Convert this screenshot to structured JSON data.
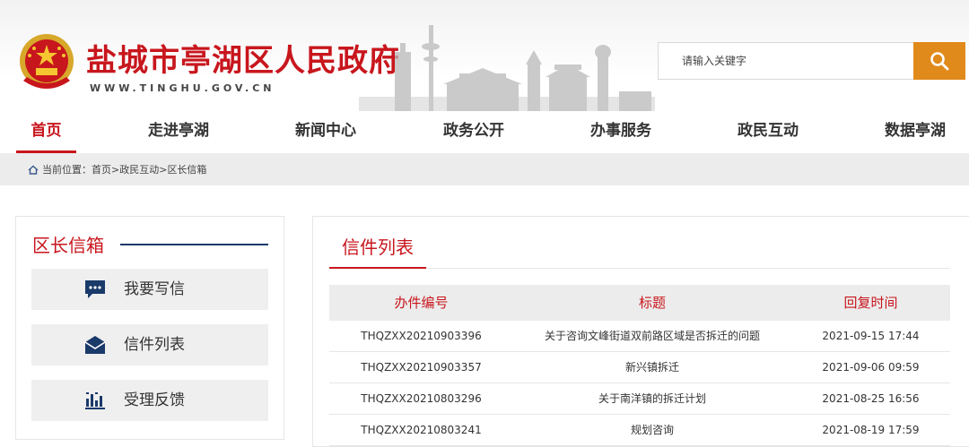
{
  "site": {
    "title": "盐城市亭湖区人民政府",
    "url": "WWW.TINGHU.GOV.CN"
  },
  "search": {
    "placeholder": "请输入关键字",
    "button_icon": "search-icon"
  },
  "nav": {
    "items": [
      {
        "label": "首页",
        "active": true
      },
      {
        "label": "走进亭湖",
        "active": false
      },
      {
        "label": "新闻中心",
        "active": false
      },
      {
        "label": "政务公开",
        "active": false
      },
      {
        "label": "办事服务",
        "active": false
      },
      {
        "label": "政民互动",
        "active": false
      },
      {
        "label": "数据亭湖",
        "active": false
      }
    ]
  },
  "breadcrumb": {
    "prefix": "当前位置：",
    "items": [
      "首页",
      "政民互动",
      "区长信箱"
    ],
    "separator": ">"
  },
  "sidebar": {
    "title": "区长信箱",
    "items": [
      {
        "label": "我要写信",
        "icon": "chat-bubble-icon"
      },
      {
        "label": "信件列表",
        "icon": "envelope-icon"
      },
      {
        "label": "受理反馈",
        "icon": "bar-chart-icon"
      }
    ]
  },
  "main": {
    "title": "信件列表",
    "columns": [
      "办件编号",
      "标题",
      "回复时间"
    ],
    "rows": [
      {
        "id": "THQZXX20210903396",
        "title": "关于咨询文峰街道双前路区域是否拆迁的问题",
        "time": "2021-09-15 17:44"
      },
      {
        "id": "THQZXX20210903357",
        "title": "新兴镇拆迁",
        "time": "2021-09-06 09:59"
      },
      {
        "id": "THQZXX20210803296",
        "title": "关于南洋镇的拆迁计划",
        "time": "2021-08-25 16:56"
      },
      {
        "id": "THQZXX20210803241",
        "title": "规划咨询",
        "time": "2021-08-19 17:59"
      }
    ]
  },
  "colors": {
    "brand_red": "#c8161d",
    "search_orange": "#e08a1b",
    "sidebar_navy": "#1a3a6a"
  }
}
